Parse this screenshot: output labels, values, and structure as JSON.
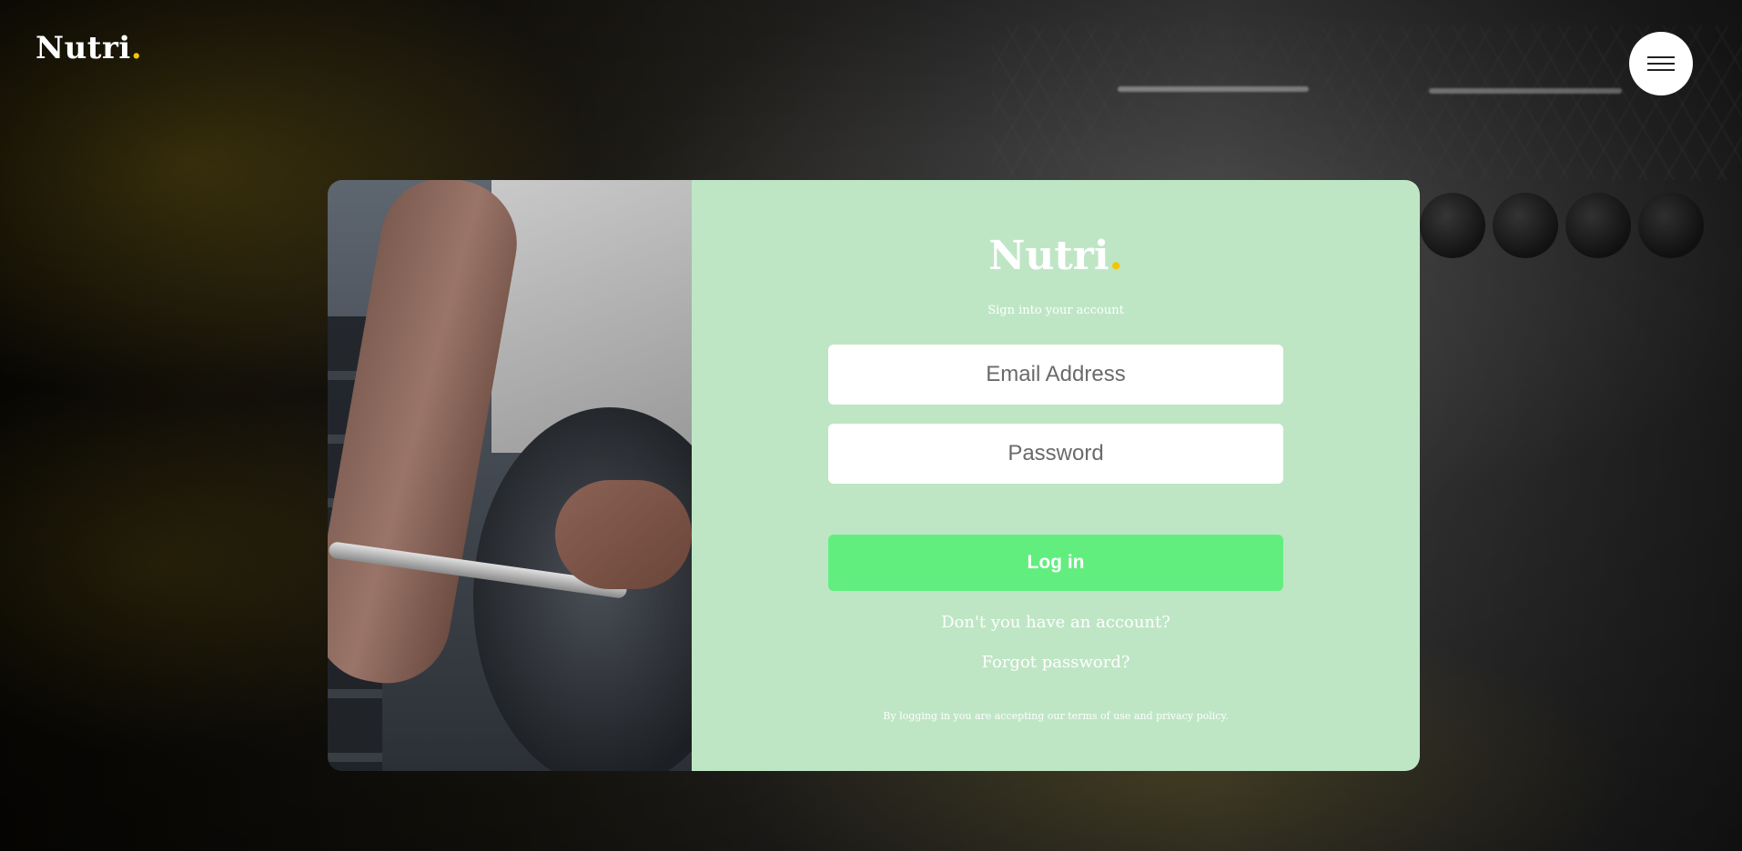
{
  "header": {
    "brand": "Nutri",
    "brand_dot": ".",
    "menu_icon": "hamburger-menu-icon"
  },
  "login": {
    "brand": "Nutri",
    "brand_dot": ".",
    "subtitle": "Sign into your account",
    "email_placeholder": "Email Address",
    "email_value": "",
    "password_placeholder": "Password",
    "password_value": "",
    "login_label": "Log in",
    "signup_link": "Don't you have an account?",
    "forgot_link": "Forgot password?",
    "terms_text": "By logging in you are accepting our terms of use and privacy policy."
  },
  "colors": {
    "panel_background": "#bee6c5",
    "button_accent": "#62ee7f",
    "brand_dot": "#f2c600",
    "text_on_panel": "#ffffff"
  }
}
